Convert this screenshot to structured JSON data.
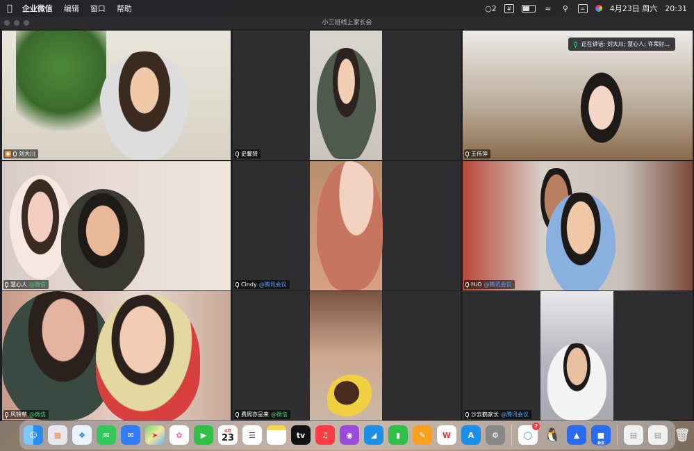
{
  "menubar": {
    "apple": "",
    "app_name": "企业微信",
    "menus": [
      "编辑",
      "窗口",
      "帮助"
    ],
    "notif_count": "2",
    "date": "4月23日 周六",
    "time": "20:31"
  },
  "window": {
    "title": "小三班线上家长会"
  },
  "speaking": {
    "label": "正在讲话: 刘大川; 慧心人; 许荣好..."
  },
  "participants": [
    {
      "name": "刘大川",
      "source": ""
    },
    {
      "name": "史馨赟",
      "source": ""
    },
    {
      "name": "王伟萍",
      "source": ""
    },
    {
      "name": "慧心人",
      "source": "@微信"
    },
    {
      "name": "Cindy",
      "source": "@腾讯会议"
    },
    {
      "name": "H₂O",
      "source": "@腾讯会议"
    },
    {
      "name": "风铃草",
      "source": "@微信"
    },
    {
      "name": "费周亦呈来",
      "source": "@微信"
    },
    {
      "name": "沙云鹤家长",
      "source": "@腾讯会议"
    }
  ],
  "dock": {
    "calendar_month": "4月",
    "calendar_day": "23",
    "appletv": "tv",
    "qq_badge": "2",
    "meeting_label": "会议",
    "colors": {
      "finder": "#2a8cf0",
      "messages": "#34c759",
      "mail": "#2f7cf6",
      "music": "#fc3c44",
      "podcasts": "#9b4bdc"
    }
  }
}
